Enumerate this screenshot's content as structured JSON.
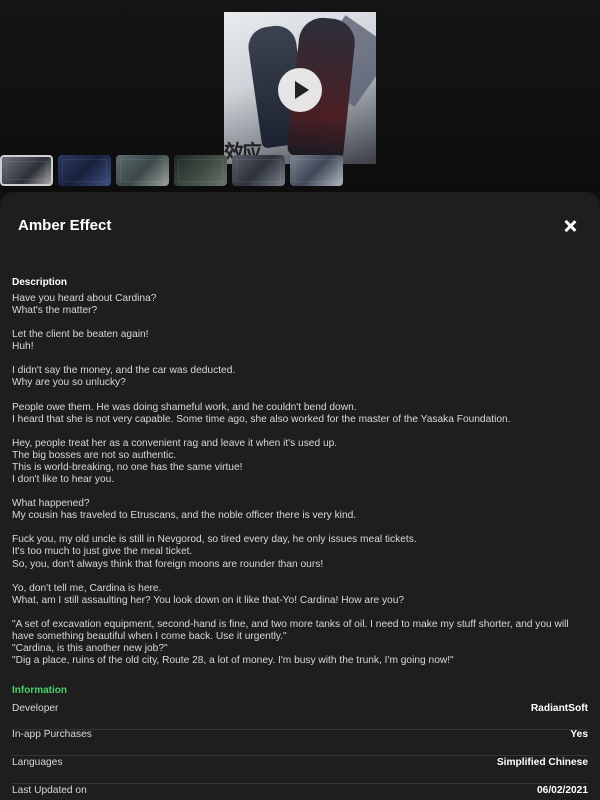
{
  "cover_logo_text": "效应",
  "title": "Amber Effect",
  "description_heading": "Description",
  "description": [
    [
      "Have you heard about Cardina?",
      "What's the matter?"
    ],
    [
      "Let the client be beaten again!",
      "Huh!"
    ],
    [
      "I didn't say the money, and the car was deducted.",
      "Why are you so unlucky?"
    ],
    [
      "People owe them. He was doing shameful work, and he couldn't bend down.",
      "I heard that she is not very capable. Some time ago, she also worked for the master of the Yasaka Foundation."
    ],
    [
      "Hey, people treat her as a convenient rag and leave it when it's used up.",
      "The big bosses are not so authentic.",
      "This is world-breaking, no one has the same virtue!",
      "I don't like to hear you."
    ],
    [
      "What happened?",
      "My cousin has traveled to Etruscans, and the noble officer there is very kind."
    ],
    [
      "Fuck you, my old uncle is still in Nevgorod, so tired every day, he only issues meal tickets.",
      "It's too much to just give the meal ticket.",
      "So, you, don't always think that foreign moons are rounder than ours!"
    ],
    [
      "Yo, don't tell me, Cardina is here.",
      "What, am I still assaulting her? You look down on it like that-Yo! Cardina! How are you?"
    ],
    [
      "\"A set of excavation equipment, second-hand is fine, and two more tanks of oil. I need to make my stuff shorter, and you will have something beautiful when I come back. Use it urgently.\"",
      "\"Cardina, is this another new job?\"",
      "\"Dig a place, ruins of the old city, Route 28, a lot of money. I'm busy with the trunk, I'm going now!\""
    ]
  ],
  "information_heading": "Information",
  "info": [
    {
      "label": "Developer",
      "value": "RadiantSoft"
    },
    {
      "label": "In-app Purchases",
      "value": "Yes"
    },
    {
      "label": "Languages",
      "value": "Simplified Chinese"
    },
    {
      "label": "Last Updated on",
      "value": "06/02/2021"
    }
  ],
  "colors": {
    "accent_green": "#49d06b",
    "sheet_bg": "#1e1e1e"
  },
  "icons": {
    "close": "close-icon",
    "play": "play-icon"
  }
}
